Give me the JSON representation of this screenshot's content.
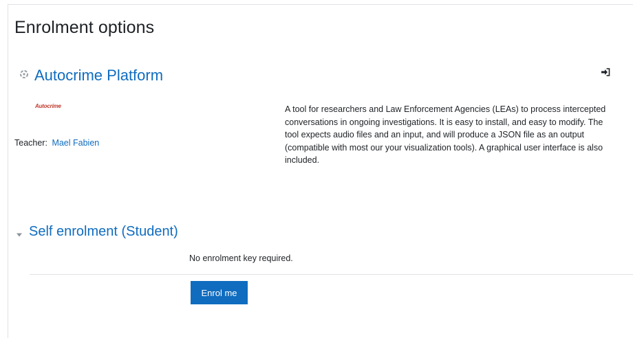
{
  "page": {
    "title": "Enrolment options"
  },
  "course": {
    "name": "Autocrime Platform",
    "logo_text": "Autocrime",
    "teacher_label": "Teacher:",
    "teacher_name": "Mael Fabien",
    "summary": "A tool for researchers and Law Enforcement Agencies (LEAs) to process intercepted conversations in ongoing investigations. It is easy to install, and easy to modify. The tool expects audio files and an input, and will produce a JSON file as an output (compatible with most our your visualization tools). A graphical user interface is also included.",
    "course_icon": "course-icon",
    "enrol_icon": "sign-in-icon"
  },
  "self_enrolment": {
    "title": "Self enrolment (Student)",
    "toggle_icon": "caret-down-icon",
    "note": "No enrolment key required.",
    "button_label": "Enrol me"
  },
  "colors": {
    "link": "#0f6cbf",
    "button_bg": "#0f6cbf",
    "text": "#1d2125",
    "border": "#dee2e6"
  }
}
